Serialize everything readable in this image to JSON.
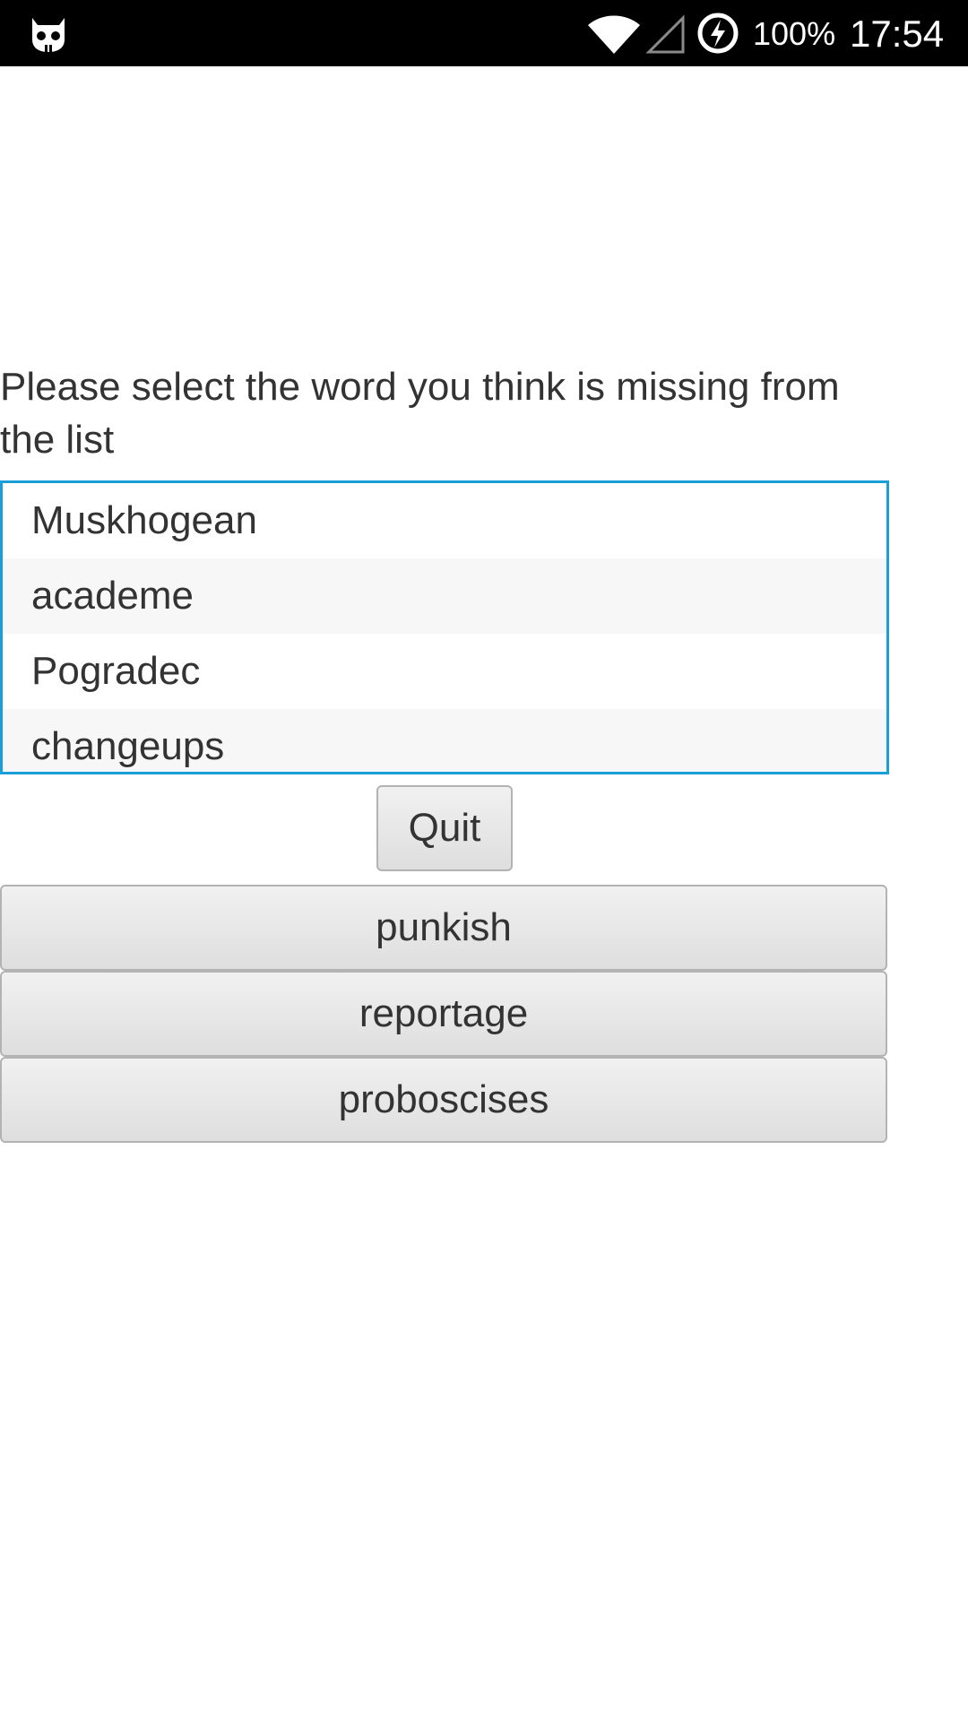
{
  "status_bar": {
    "battery_percent": "100%",
    "time": "17:54",
    "icons": [
      "cyanogenmod-icon",
      "wifi-icon",
      "signal-icon",
      "battery-charging-icon"
    ]
  },
  "prompt": "Please select the word you think is missing from the list",
  "word_list": {
    "items": [
      "Muskhogean",
      "academe",
      "Pogradec",
      "changeups"
    ],
    "border_color": "#1a9ed8"
  },
  "buttons": {
    "quit_label": "Quit",
    "choices": [
      "punkish",
      "reportage",
      "proboscises"
    ]
  }
}
